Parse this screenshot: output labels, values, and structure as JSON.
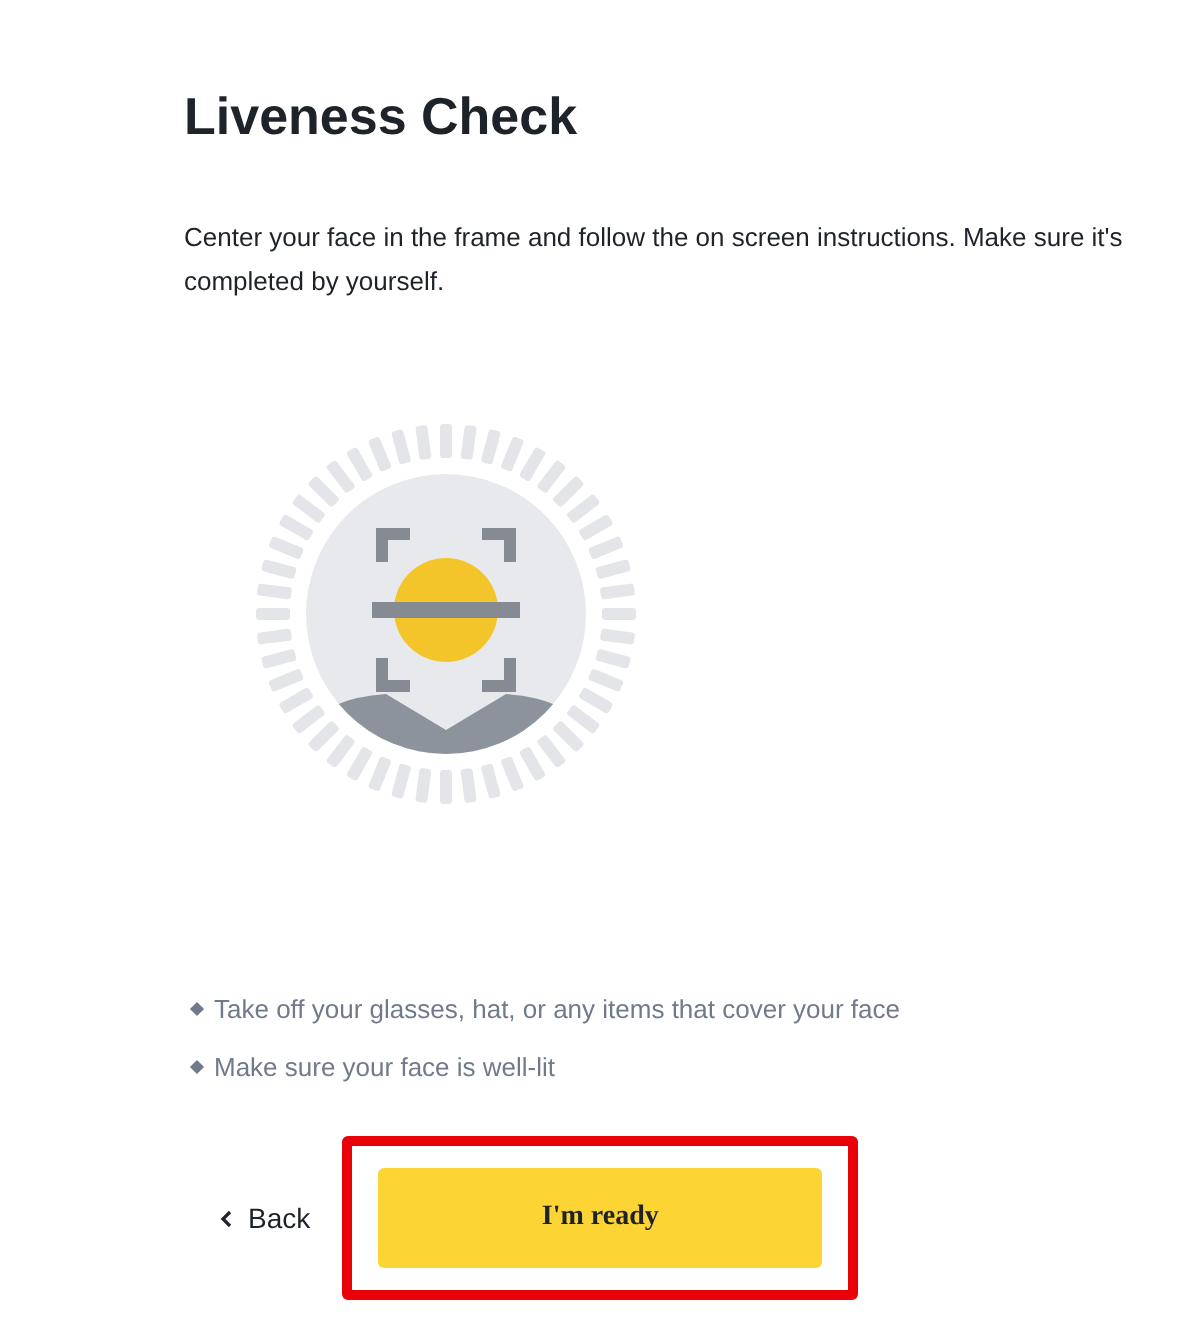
{
  "title": "Liveness Check",
  "description": "Center your face in the frame and follow the on screen instructions. Make sure it's completed by yourself.",
  "tips": [
    "Take off your glasses, hat, or any items that cover your face",
    "Make sure your face is well-lit"
  ],
  "back_button": {
    "label": "Back"
  },
  "primary_button": {
    "label": "I'm ready",
    "highlighted": true
  }
}
